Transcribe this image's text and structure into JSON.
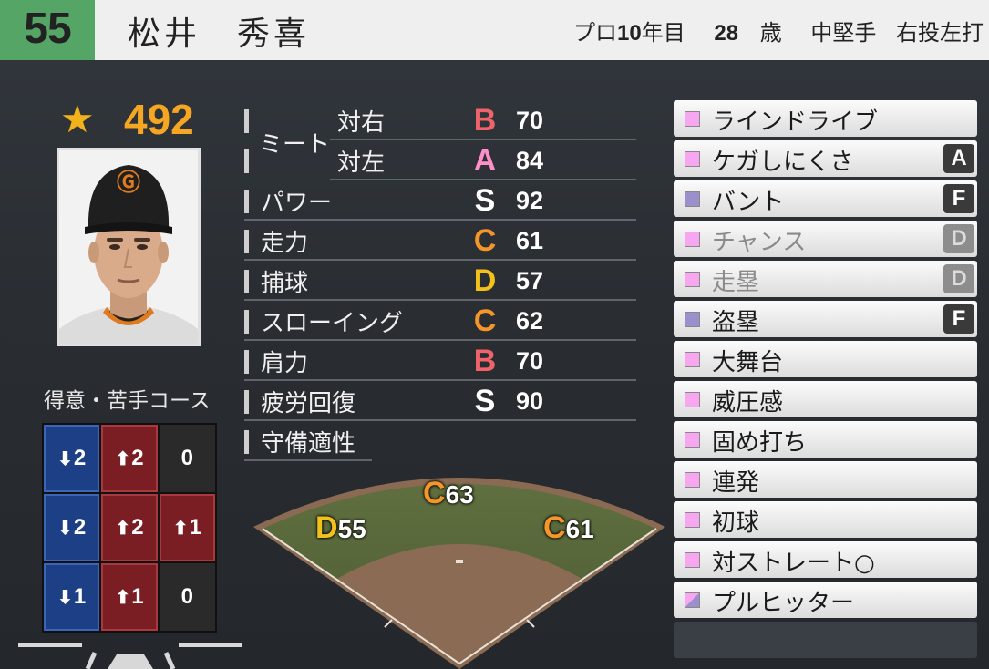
{
  "player": {
    "number": "55",
    "name": "松井　秀喜",
    "career": "プロ",
    "career_years": "10",
    "career_suffix": "年目",
    "age": "28",
    "age_suffix": "歳",
    "position": "中堅手",
    "handedness": "右投左打"
  },
  "overall": {
    "icon": "star-icon",
    "value": "492"
  },
  "course": {
    "title": "得意・苦手コース",
    "cells": [
      {
        "dir": "down",
        "value": "2",
        "tone": "blue"
      },
      {
        "dir": "up",
        "value": "2",
        "tone": "red"
      },
      {
        "dir": "",
        "value": "0",
        "tone": "neutral"
      },
      {
        "dir": "down",
        "value": "2",
        "tone": "blue"
      },
      {
        "dir": "up",
        "value": "2",
        "tone": "red"
      },
      {
        "dir": "up",
        "value": "1",
        "tone": "red"
      },
      {
        "dir": "down",
        "value": "1",
        "tone": "blue"
      },
      {
        "dir": "up",
        "value": "1",
        "tone": "red"
      },
      {
        "dir": "",
        "value": "0",
        "tone": "neutral"
      }
    ]
  },
  "stats": {
    "meet_label": "ミート",
    "meet_right_label": "対右",
    "meet_right_grade": "B",
    "meet_right_value": "70",
    "meet_left_label": "対左",
    "meet_left_grade": "A",
    "meet_left_value": "84",
    "power_label": "パワー",
    "power_grade": "S",
    "power_value": "92",
    "speed_label": "走力",
    "speed_grade": "C",
    "speed_value": "61",
    "catch_label": "捕球",
    "catch_grade": "D",
    "catch_value": "57",
    "throw_label": "スローイング",
    "throw_grade": "C",
    "throw_value": "62",
    "arm_label": "肩力",
    "arm_grade": "B",
    "arm_value": "70",
    "recovery_label": "疲労回復",
    "recovery_grade": "S",
    "recovery_value": "90",
    "fielding_label": "守備適性"
  },
  "grade_colors": {
    "S": "#ffffff",
    "A": "#ff8fc8",
    "B": "#f0636a",
    "C": "#f4962a",
    "D": "#f3c21a",
    "F": "#ffffff"
  },
  "field_positions": {
    "cf_grade": "C",
    "cf_value": "63",
    "lf_grade": "D",
    "lf_value": "55",
    "rf_grade": "C",
    "rf_value": "61"
  },
  "abilities": [
    {
      "label": "ラインドライブ",
      "rank": "",
      "marker": "pink"
    },
    {
      "label": "ケガしにくさ",
      "rank": "A",
      "marker": "pink"
    },
    {
      "label": "バント",
      "rank": "F",
      "marker": "purple"
    },
    {
      "label": "チャンス",
      "rank": "D",
      "marker": "pink",
      "dim": true
    },
    {
      "label": "走塁",
      "rank": "D",
      "marker": "pink",
      "dim": true
    },
    {
      "label": "盗塁",
      "rank": "F",
      "marker": "purple"
    },
    {
      "label": "大舞台",
      "rank": "",
      "marker": "pink"
    },
    {
      "label": "威圧感",
      "rank": "",
      "marker": "pink"
    },
    {
      "label": "固め打ち",
      "rank": "",
      "marker": "pink"
    },
    {
      "label": "連発",
      "rank": "",
      "marker": "pink"
    },
    {
      "label": "初球",
      "rank": "",
      "marker": "pink"
    },
    {
      "label": "対ストレート○",
      "rank": "",
      "marker": "pink"
    },
    {
      "label": "プルヒッター",
      "rank": "",
      "marker": "half"
    }
  ],
  "marker_colors": {
    "pink": "#f7a6f0",
    "purple": "#9b8fcc"
  }
}
